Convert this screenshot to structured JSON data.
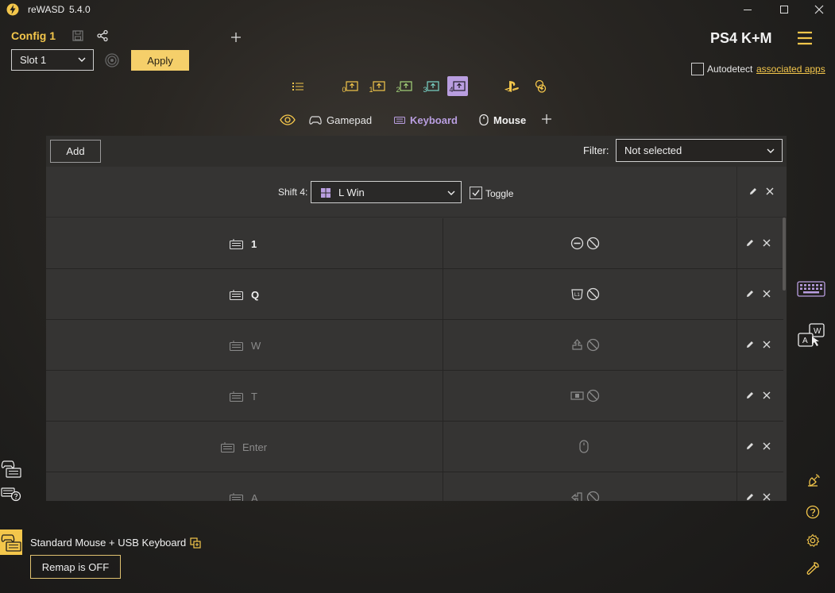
{
  "app": {
    "name": "reWASD",
    "version": "5.4.0"
  },
  "config": {
    "name": "Config 1",
    "slot": "Slot 1",
    "apply_label": "Apply"
  },
  "device": {
    "title": "PS4 K+M",
    "name": "Standard Mouse + USB Keyboard",
    "remap_label": "Remap is OFF"
  },
  "autodetect": {
    "label": "Autodetect",
    "link": "associated apps",
    "checked": false
  },
  "shift_icons": [
    {
      "name": "list-icon",
      "label": ""
    },
    {
      "name": "shift-0-icon",
      "label": "0"
    },
    {
      "name": "shift-1-icon",
      "label": "1"
    },
    {
      "name": "shift-2-icon",
      "label": "2"
    },
    {
      "name": "shift-3-icon",
      "label": "3"
    },
    {
      "name": "shift-4-icon",
      "label": "4",
      "active": true
    }
  ],
  "tabs": {
    "gamepad": "Gamepad",
    "keyboard": "Keyboard",
    "mouse": "Mouse"
  },
  "toolbar": {
    "add_label": "Add",
    "filter_label": "Filter:",
    "filter_value": "Not selected"
  },
  "shift": {
    "label": "Shift 4:",
    "key": "L Win",
    "toggle_label": "Toggle",
    "toggle_checked": true
  },
  "mappings": [
    {
      "key": "1",
      "target": "minus-icon",
      "enabled": true
    },
    {
      "key": "Q",
      "target": "l1-icon",
      "enabled": true
    },
    {
      "key": "W",
      "target": "stick-up-icon",
      "enabled": false
    },
    {
      "key": "T",
      "target": "touchpad-icon",
      "enabled": false
    },
    {
      "key": "Enter",
      "target": "mouse-icon",
      "enabled": false
    },
    {
      "key": "A",
      "target": "stick-left-icon",
      "enabled": false
    }
  ],
  "colors": {
    "accent": "#f3c64b",
    "active_tab": "#b99ee0",
    "apply_bg": "#f5cf6a"
  }
}
